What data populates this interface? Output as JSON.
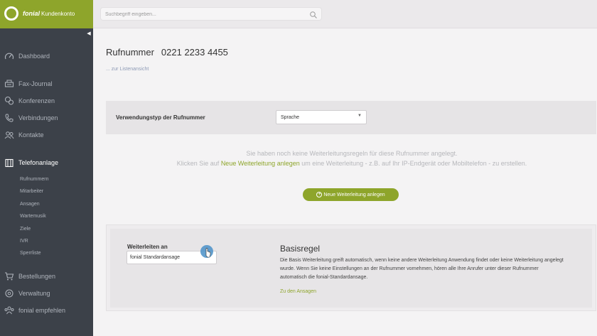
{
  "brand": {
    "name": "fonial",
    "subtitle": "Kundenkonto"
  },
  "search": {
    "placeholder": "Suchbegriff eingeben..."
  },
  "sidebar": {
    "collapse_glyph": "◀",
    "items": [
      {
        "label": "Dashboard",
        "icon": "gauge-icon"
      },
      {
        "label": "Fax-Journal",
        "icon": "fax-icon"
      },
      {
        "label": "Konferenzen",
        "icon": "conference-icon"
      },
      {
        "label": "Verbindungen",
        "icon": "phone-icon"
      },
      {
        "label": "Kontakte",
        "icon": "contacts-icon"
      },
      {
        "label": "Telefonanlage",
        "icon": "phone-system-icon",
        "active": true
      },
      {
        "label": "Bestellungen",
        "icon": "cart-icon"
      },
      {
        "label": "Verwaltung",
        "icon": "settings-icon"
      },
      {
        "label": "fonial empfehlen",
        "icon": "recommend-icon"
      }
    ],
    "subitems": [
      "Rufnummern",
      "Mitarbeiter",
      "Ansagen",
      "Wartemusik",
      "Ziele",
      "IVR",
      "Sperrliste"
    ]
  },
  "main": {
    "title": "Rufnummer",
    "number": "0221 2233 4455",
    "back_link": "... zur Listenansicht",
    "type_label": "Verwendungstyp der Rufnummer",
    "type_value": "Sprache",
    "notice_line1": "Sie haben noch keine Weiterleitungsregeln für diese Rufnummer angelegt.",
    "notice_pre": "Klicken Sie auf ",
    "notice_link": "Neue Weiterleitung anlegen",
    "notice_post": " um eine Weiterleitung - z.B. auf Ihr IP-Endgerät oder Mobiltelefon - zu erstellen.",
    "new_button": "Neue Weiterleitung anlegen",
    "forward_label": "Weiterleiten an",
    "forward_value": "fonial Standardansage",
    "rule_title": "Basisregel",
    "rule_desc": "Die Basis Weiterleitung greift automatisch, wenn keine andere Weiterleitung Anwendung findet oder keine Weiterleitung angelegt wurde. Wenn Sie keine Einstellungen an der Rufnummer vornehmen, hören alle Ihre Anrufer unter dieser Rufnummer automatisch die fonial-Standardansage.",
    "rule_link": "Zu den Ansagen"
  },
  "colors": {
    "accent": "#8ea52b",
    "sidebar": "#3c4149",
    "cursor": "#4a90c8"
  }
}
